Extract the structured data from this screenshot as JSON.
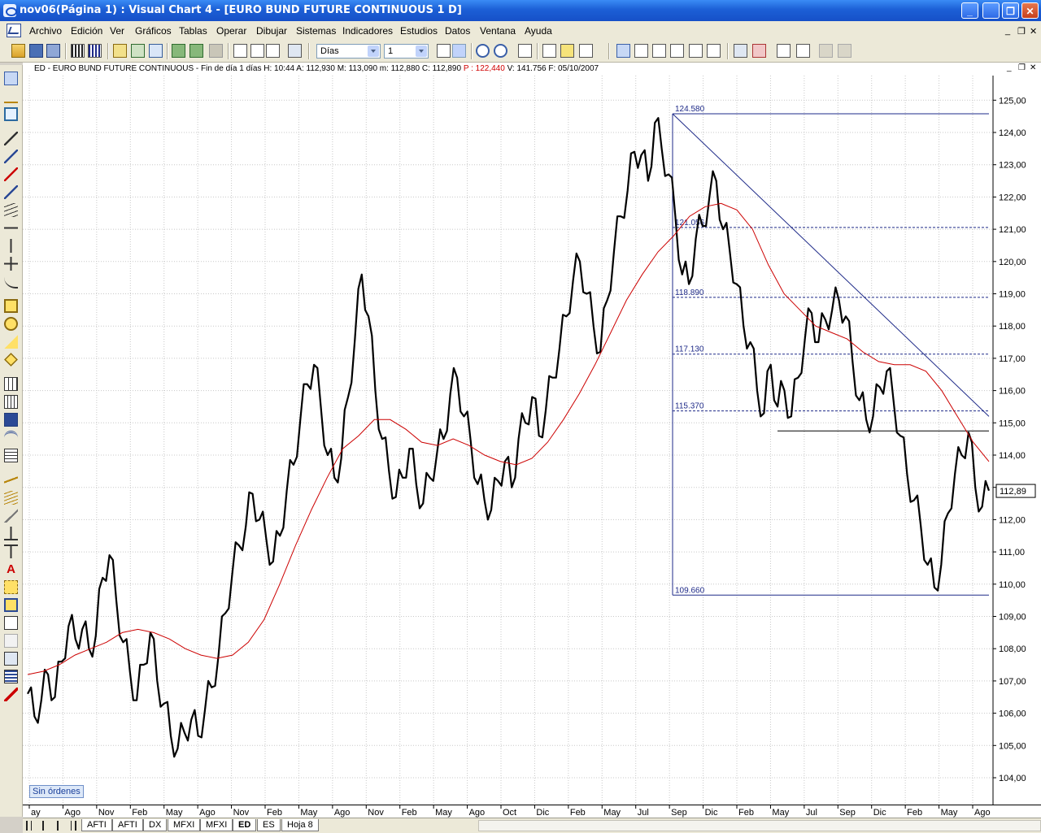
{
  "window": {
    "title": "nov06(Página 1) : Visual Chart 4 - [EURO BUND FUTURE CONTINUOUS 1 D]",
    "minimize_glyph": "_",
    "restore_glyph": "❐",
    "close_glyph": "✕"
  },
  "menu": {
    "items": [
      "Archivo",
      "Edición",
      "Ver",
      "Gráficos",
      "Tablas",
      "Operar",
      "Dibujar",
      "Sistemas",
      "Indicadores",
      "Estudios",
      "Datos",
      "Ventana",
      "Ayuda"
    ],
    "mdi_minimize": "_",
    "mdi_restore": "❐",
    "mdi_close": "✕"
  },
  "toolbar": {
    "period_select": "Días",
    "multiplier_select": "1"
  },
  "info": {
    "text": "ED - EURO BUND FUTURE CONTINUOUS - Fin de día 1 días H: 10:44  A: 112,930  M: 113,090  m: 112,880  C: 112,890",
    "p_value": "P : 122,440",
    "tail": "V: 141.756  F: 05/10/2007",
    "ctrl_min": "_",
    "ctrl_restore": "❐",
    "ctrl_close": "✕"
  },
  "orders_label": "Sin órdenes",
  "tabs": [
    "AFTI",
    "AFTI",
    "DX",
    "MFXI",
    "MFXI",
    "ED",
    "ES",
    "Hoja 8"
  ],
  "active_tab": 5,
  "colors": {
    "price": "#000000",
    "moving_average": "#cc0000",
    "drawing": "#1e2a88",
    "grid": "#c8c8c8"
  },
  "chart_data": {
    "type": "line",
    "ylim": [
      104,
      125
    ],
    "yticks": [
      "104,00",
      "105,00",
      "106,00",
      "107,00",
      "108,00",
      "109,00",
      "110,00",
      "111,00",
      "112,00",
      "113,00",
      "114,00",
      "115,00",
      "116,00",
      "117,00",
      "118,00",
      "119,00",
      "120,00",
      "121,00",
      "122,00",
      "123,00",
      "124,00",
      "125,00"
    ],
    "x_categories": [
      "ay",
      "Ago",
      "Nov",
      "Feb",
      "May",
      "Ago",
      "Nov",
      "Feb",
      "May",
      "Ago",
      "Nov",
      "Feb",
      "May",
      "Ago",
      "Oct",
      "Dic",
      "Feb",
      "May",
      "Jul",
      "Sep",
      "Dic",
      "Feb",
      "May",
      "Jul",
      "Sep",
      "Dic",
      "Feb",
      "May",
      "Ago"
    ],
    "series": [
      {
        "values": [
          106.6,
          105.9,
          106.4,
          107.2,
          106.5,
          107.6,
          108.7,
          108.3,
          108.6,
          108.0,
          108.4,
          110.2,
          110.9,
          109.5,
          108.2,
          107.3,
          106.4,
          107.5,
          108.5,
          107.0,
          106.3,
          105.3,
          104.9,
          105.4,
          105.8,
          105.3,
          106.1,
          106.8,
          107.8,
          109.1,
          110.3,
          111.2,
          111.8,
          112.8,
          112.0,
          111.4,
          110.7,
          111.5,
          112.9,
          113.7,
          115.1,
          116.2,
          116.8,
          115.5,
          114.0,
          113.3,
          113.9,
          115.8,
          117.6,
          119.6,
          118.3,
          116.0,
          114.5,
          113.5,
          112.7,
          113.3,
          114.2,
          113.1,
          112.5,
          113.3,
          114.0,
          114.5,
          115.9,
          116.4,
          115.2,
          114.4,
          113.1,
          112.6,
          112.3,
          113.2,
          113.8,
          113.0,
          114.5,
          115.0,
          115.8,
          114.6,
          115.4,
          116.4,
          117.3,
          118.3,
          119.4,
          120.0,
          119.0,
          118.0,
          117.2,
          118.8,
          120.3,
          121.4,
          122.2,
          123.4,
          123.3,
          122.5,
          124.3,
          123.5,
          122.7,
          121.4,
          119.6,
          119.3,
          120.7,
          121.1,
          122.0,
          122.5,
          121.0,
          120.3,
          119.3,
          118.0,
          117.5,
          116.0,
          115.3,
          116.8,
          115.5,
          116.0,
          115.2,
          116.4,
          117.6,
          118.4,
          117.5,
          118.2,
          118.5,
          118.8,
          118.3,
          116.9,
          115.7,
          115.1,
          115.2,
          116.1,
          116.6,
          115.7,
          114.6,
          113.4,
          112.6,
          111.8,
          110.6,
          109.9,
          110.6,
          112.2,
          113.4,
          114.0,
          114.7,
          113.0,
          112.4,
          112.9
        ]
      },
      {
        "values": [
          107.2,
          107.3,
          107.5,
          107.8,
          108.0,
          108.2,
          108.5,
          108.6,
          108.5,
          108.3,
          108.0,
          107.8,
          107.7,
          107.8,
          108.2,
          108.9,
          110.0,
          111.2,
          112.3,
          113.3,
          114.2,
          114.6,
          115.1,
          115.1,
          114.8,
          114.4,
          114.3,
          114.5,
          114.3,
          114.0,
          113.8,
          113.7,
          113.9,
          114.4,
          115.1,
          115.9,
          116.8,
          117.8,
          118.8,
          119.6,
          120.3,
          120.8,
          121.4,
          121.7,
          121.8,
          121.6,
          121.0,
          119.9,
          119.0,
          118.5,
          118.0,
          117.8,
          117.6,
          117.2,
          116.9,
          116.8,
          116.8,
          116.6,
          116.0,
          115.2,
          114.4,
          113.8
        ]
      }
    ],
    "fibonacci": {
      "levels": [
        "124.580",
        "121.056",
        "118.890",
        "117.130",
        "115.370",
        "109.660"
      ]
    },
    "last_price_label": "112,89"
  }
}
